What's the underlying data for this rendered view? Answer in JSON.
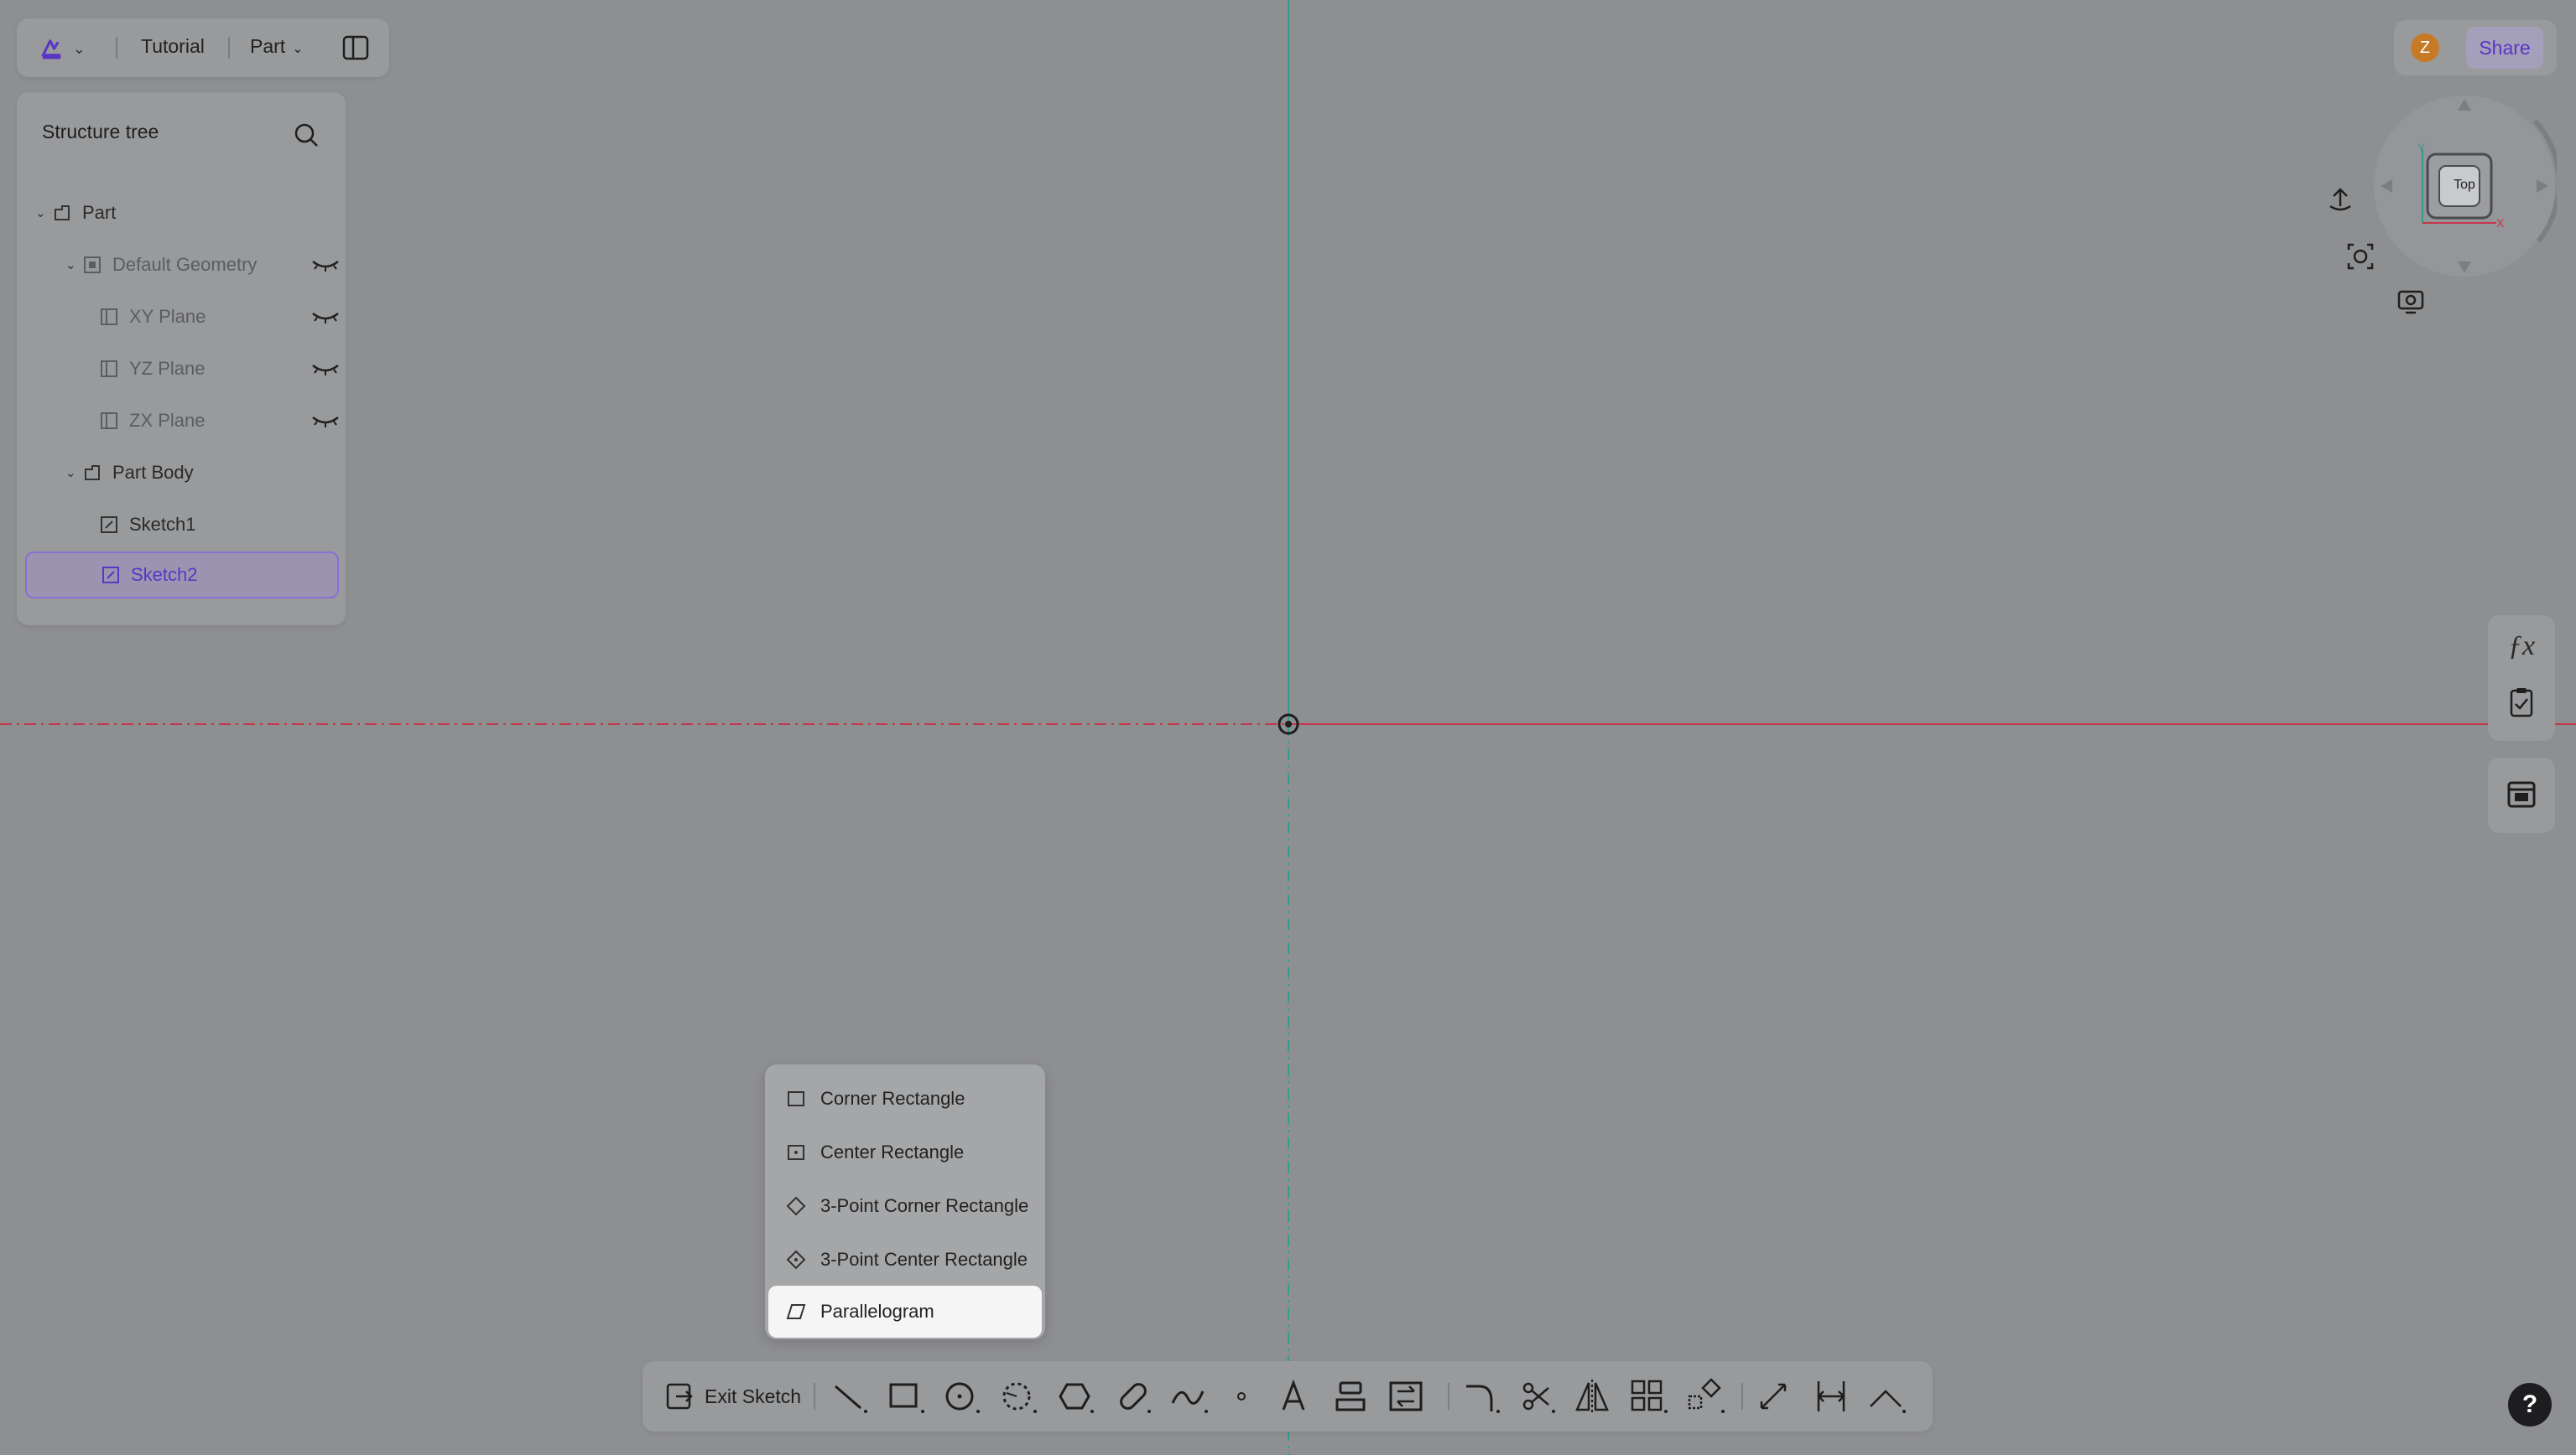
{
  "topbar": {
    "doc_title": "Tutorial",
    "mode_label": "Part"
  },
  "tree": {
    "header": "Structure tree",
    "items": [
      {
        "label": "Part"
      },
      {
        "label": "Default Geometry"
      },
      {
        "label": "XY Plane"
      },
      {
        "label": "YZ Plane"
      },
      {
        "label": "ZX Plane"
      },
      {
        "label": "Part Body"
      },
      {
        "label": "Sketch1"
      },
      {
        "label": "Sketch2"
      }
    ]
  },
  "header_right": {
    "avatar_letter": "Z",
    "share_label": "Share"
  },
  "viewcube": {
    "face_label": "Top",
    "axis_x": "X",
    "axis_y": "Y"
  },
  "dropdown": {
    "items": [
      {
        "label": "Corner Rectangle",
        "icon": "corner-rectangle-icon"
      },
      {
        "label": "Center Rectangle",
        "icon": "center-rectangle-icon"
      },
      {
        "label": "3-Point Corner Rectangle",
        "icon": "three-point-corner-rectangle-icon"
      },
      {
        "label": "3-Point Center Rectangle",
        "icon": "three-point-center-rectangle-icon"
      },
      {
        "label": "Parallelogram",
        "icon": "parallelogram-icon"
      }
    ],
    "active": "Parallelogram"
  },
  "bottombar": {
    "exit_label": "Exit Sketch"
  },
  "help_label": "?",
  "colors": {
    "background": "#8e8f91",
    "accent": "#5a36c4",
    "axis_x": "#c4364a",
    "axis_y": "#2f9e8a"
  }
}
